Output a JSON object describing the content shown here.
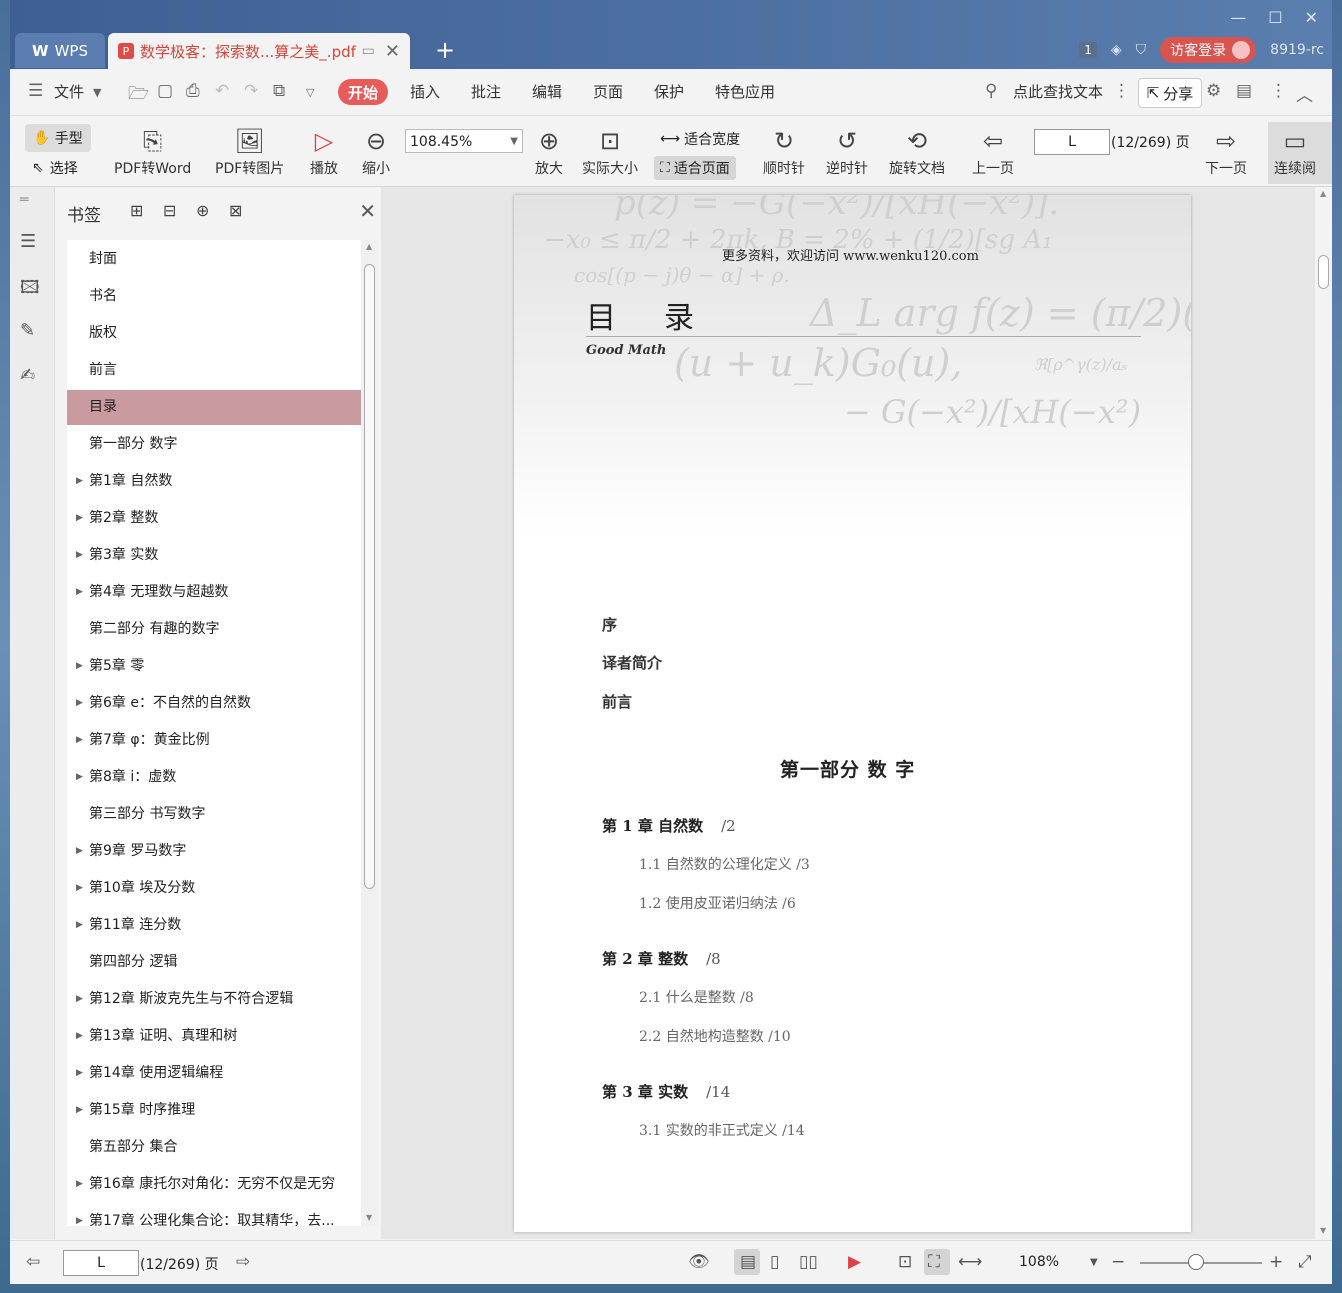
{
  "app": {
    "name": "WPS",
    "doc_tab_title": "数学极客：探索数...算之美_.pdf",
    "window_count": "1",
    "login_label": "访客登录",
    "user_id": "8919-rc"
  },
  "menubar": {
    "file": "文件",
    "tabs": [
      "开始",
      "插入",
      "批注",
      "编辑",
      "页面",
      "保护",
      "特色应用"
    ],
    "search_label": "点此查找文本",
    "share_label": "分享"
  },
  "toolbar": {
    "hand": "手型",
    "select": "选择",
    "pdf_to_word": "PDF转Word",
    "pdf_to_image": "PDF转图片",
    "play": "播放",
    "zoom_out": "缩小",
    "zoom_value": "108.45%",
    "zoom_in": "放大",
    "actual_size": "实际大小",
    "fit_width": "适合宽度",
    "fit_page": "适合页面",
    "clockwise": "顺时针",
    "counter_clockwise": "逆时针",
    "rotate_doc": "旋转文档",
    "prev_page": "上一页",
    "page_input": "L",
    "page_count": "(12/269) 页",
    "next_page": "下一页",
    "continuous": "连续阅"
  },
  "bookmarks": {
    "title": "书签",
    "items": [
      {
        "label": "封面",
        "expandable": false,
        "selected": false
      },
      {
        "label": "书名",
        "expandable": false,
        "selected": false
      },
      {
        "label": "版权",
        "expandable": false,
        "selected": false
      },
      {
        "label": "前言",
        "expandable": false,
        "selected": false
      },
      {
        "label": "目录",
        "expandable": false,
        "selected": true
      },
      {
        "label": "第一部分 数字",
        "expandable": false,
        "selected": false
      },
      {
        "label": "第1章 自然数",
        "expandable": true,
        "selected": false
      },
      {
        "label": "第2章 整数",
        "expandable": true,
        "selected": false
      },
      {
        "label": "第3章 实数",
        "expandable": true,
        "selected": false
      },
      {
        "label": "第4章 无理数与超越数",
        "expandable": true,
        "selected": false
      },
      {
        "label": "第二部分 有趣的数字",
        "expandable": false,
        "selected": false
      },
      {
        "label": "第5章 零",
        "expandable": true,
        "selected": false
      },
      {
        "label": "第6章 e：不自然的自然数",
        "expandable": true,
        "selected": false
      },
      {
        "label": "第7章 φ：黄金比例",
        "expandable": true,
        "selected": false
      },
      {
        "label": "第8章 i：虚数",
        "expandable": true,
        "selected": false
      },
      {
        "label": "第三部分 书写数字",
        "expandable": false,
        "selected": false
      },
      {
        "label": "第9章 罗马数字",
        "expandable": true,
        "selected": false
      },
      {
        "label": "第10章 埃及分数",
        "expandable": true,
        "selected": false
      },
      {
        "label": "第11章 连分数",
        "expandable": true,
        "selected": false
      },
      {
        "label": "第四部分 逻辑",
        "expandable": false,
        "selected": false
      },
      {
        "label": "第12章 斯波克先生与不符合逻辑",
        "expandable": true,
        "selected": false
      },
      {
        "label": "第13章 证明、真理和树",
        "expandable": true,
        "selected": false
      },
      {
        "label": "第14章 使用逻辑编程",
        "expandable": true,
        "selected": false
      },
      {
        "label": "第15章 时序推理",
        "expandable": true,
        "selected": false
      },
      {
        "label": "第五部分 集合",
        "expandable": false,
        "selected": false
      },
      {
        "label": "第16章 康托尔对角化：无穷不仅是无穷",
        "expandable": true,
        "selected": false
      },
      {
        "label": "第17章 公理化集合论：取其精华，去...",
        "expandable": true,
        "selected": false
      }
    ]
  },
  "page": {
    "header": "更多资料，欢迎访问  www.wenku120.com",
    "title": "目录",
    "subtitle": "Good Math",
    "formulas": [
      "p(z) = −G(−x²)/[xH(−x²)].",
      "−x₀ ≤ π/2 + 2πk,  B = 2% + (1/2)[sg A₁",
      "cos[(p − j)θ − α] + ρ.",
      "Δ_L arg f(z) = (π/2)(S",
      "(u + u_k)G₀(u),",
      "ℜ[ρ^γ(z)/aₛ",
      "− G(−x²)/[xH(−x²)"
    ],
    "preface": [
      "序",
      "译者简介",
      "前言"
    ],
    "part": "第一部分  数    字",
    "toc": [
      {
        "kind": "ch",
        "text": "第 1 章   自然数",
        "page": "/2"
      },
      {
        "kind": "sec",
        "text": "1.1   自然数的公理化定义   /3"
      },
      {
        "kind": "sec",
        "text": "1.2   使用皮亚诺归纳法   /6"
      },
      {
        "kind": "ch",
        "text": "第 2 章   整数",
        "page": "/8"
      },
      {
        "kind": "sec",
        "text": "2.1   什么是整数   /8"
      },
      {
        "kind": "sec",
        "text": "2.2   自然地构造整数   /10"
      },
      {
        "kind": "ch",
        "text": "第 3 章   实数",
        "page": "/14"
      },
      {
        "kind": "sec",
        "text": "3.1   实数的非正式定义   /14"
      }
    ]
  },
  "status": {
    "page_input": "L",
    "page_count": "(12/269) 页",
    "zoom": "108%"
  },
  "colors": {
    "accent": "#e85b5b",
    "selected_bookmark": "#c99aa0",
    "titlebar": "#4a6a9c"
  }
}
